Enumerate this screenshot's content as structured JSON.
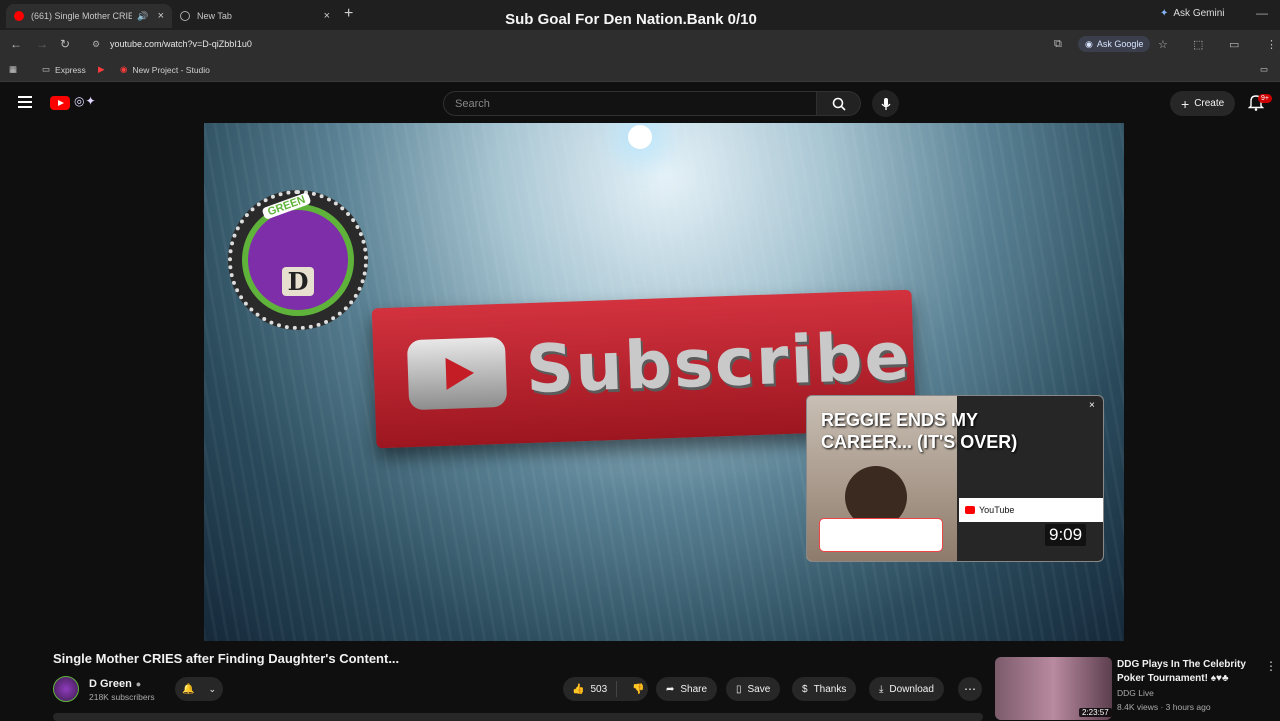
{
  "browser": {
    "tabs": [
      {
        "title": "(661) Single Mother CRIES",
        "active": true
      },
      {
        "title": "New Tab",
        "active": false
      }
    ],
    "overlay_title": "Sub Goal For Den Nation.Bank 0/10",
    "gemini_label": "Ask Gemini",
    "url": "youtube.com/watch?v=D-qiZbbI1u0",
    "ask_google": "Ask Google",
    "bookmarks": [
      "Express",
      "New Project - Studio"
    ]
  },
  "youtube": {
    "search_placeholder": "Search",
    "create_label": "Create",
    "notification_badge": "9+"
  },
  "player": {
    "thumbnail_text": "Subscribe",
    "badge_text": "GREEN",
    "badge_letter": "D",
    "endcard": {
      "title": "REGGIE ENDS MY CAREER... (IT'S OVER)",
      "duration": "9:09",
      "inner_brand": "YouTube"
    }
  },
  "video": {
    "title": "Single Mother CRIES after Finding Daughter's Content...",
    "channel": "D Green",
    "subscribers": "218K subscribers",
    "likes": "503",
    "actions": {
      "share": "Share",
      "save": "Save",
      "thanks": "Thanks",
      "download": "Download"
    }
  },
  "recommendation": {
    "title": "DDG Plays In The Celebrity Poker Tournament! ♠♥♣",
    "channel": "DDG Live",
    "meta": "8.4K views · 3 hours ago",
    "duration": "2:23:57"
  },
  "colors": {
    "youtube_red": "#ff0000",
    "background": "#0f0f0f",
    "pill": "#272727"
  }
}
